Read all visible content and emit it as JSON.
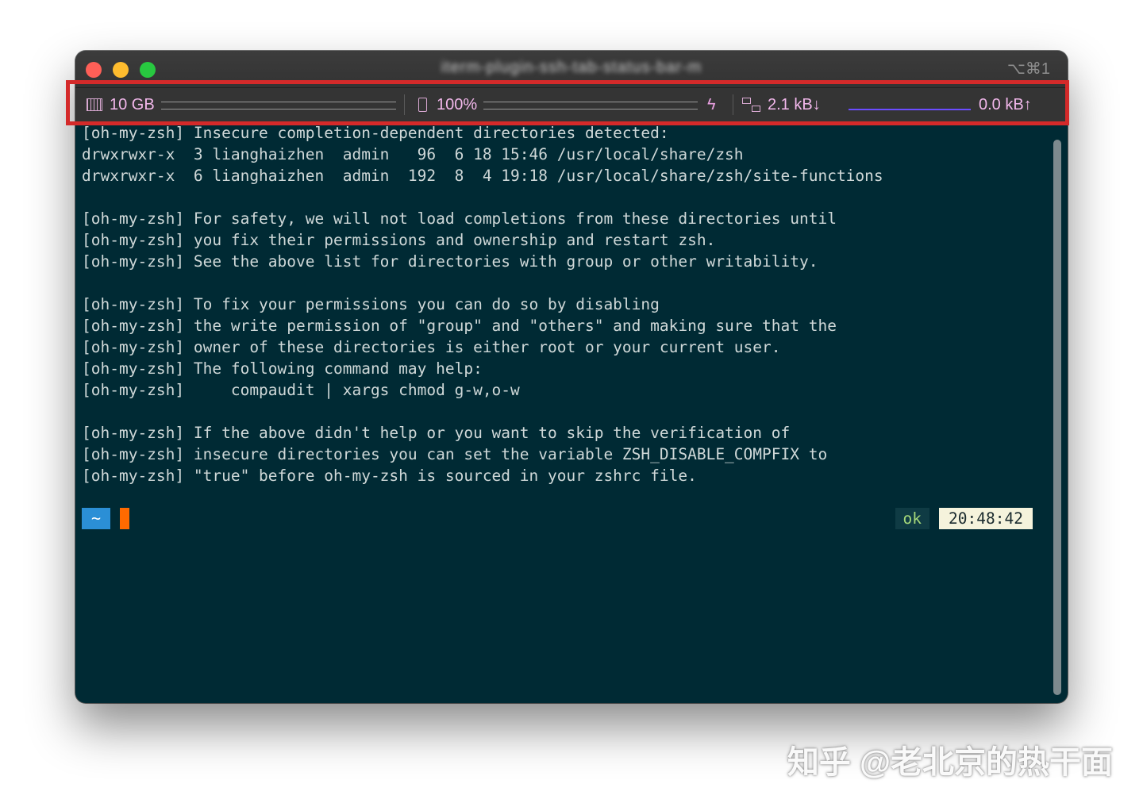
{
  "window": {
    "title": "iterm-plugin-ssh-tab-status-bar-m",
    "shortcut": "⌥⌘1"
  },
  "status_bar": {
    "memory": "10 GB",
    "battery": "100%",
    "network_down": "2.1 kB↓",
    "network_up": "0.0 kB↑"
  },
  "terminal": {
    "lines": [
      "[oh-my-zsh] Insecure completion-dependent directories detected:",
      "drwxrwxr-x  3 lianghaizhen  admin   96  6 18 15:46 /usr/local/share/zsh",
      "drwxrwxr-x  6 lianghaizhen  admin  192  8  4 19:18 /usr/local/share/zsh/site-functions",
      "",
      "[oh-my-zsh] For safety, we will not load completions from these directories until",
      "[oh-my-zsh] you fix their permissions and ownership and restart zsh.",
      "[oh-my-zsh] See the above list for directories with group or other writability.",
      "",
      "[oh-my-zsh] To fix your permissions you can do so by disabling",
      "[oh-my-zsh] the write permission of \"group\" and \"others\" and making sure that the",
      "[oh-my-zsh] owner of these directories is either root or your current user.",
      "[oh-my-zsh] The following command may help:",
      "[oh-my-zsh]     compaudit | xargs chmod g-w,o-w",
      "",
      "[oh-my-zsh] If the above didn't help or you want to skip the verification of",
      "[oh-my-zsh] insecure directories you can set the variable ZSH_DISABLE_COMPFIX to",
      "[oh-my-zsh] \"true\" before oh-my-zsh is sourced in your zshrc file."
    ]
  },
  "prompt": {
    "directory": "~",
    "status": "ok",
    "time": "20:48:42"
  },
  "watermark": "知乎 @老北京的热干面",
  "colors": {
    "terminal_bg": "#002a34",
    "status_text": "#f3b8ec",
    "prompt_dir_bg": "#2b8fd6",
    "cursor": "#ff6a00",
    "highlight_box": "#d42a2a"
  }
}
